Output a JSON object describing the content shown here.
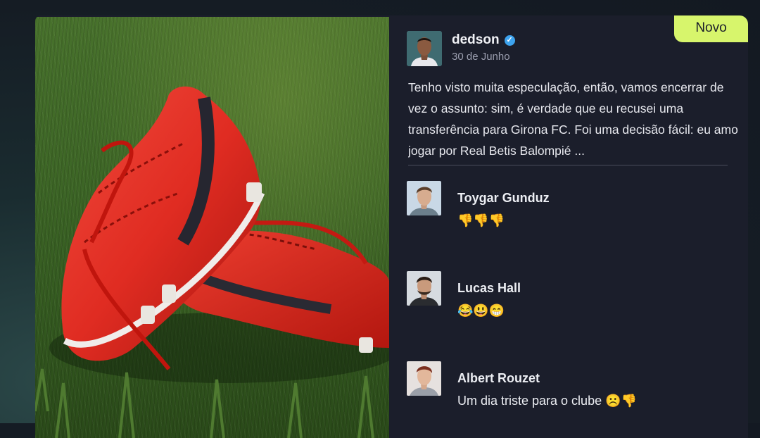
{
  "badge": "Novo",
  "post": {
    "author": "dedson",
    "verified": true,
    "date": "30 de Junho",
    "text": "Tenho visto muita especulação, então, vamos encerrar de vez o assunto: sim, é verdade que eu recusei uma transferência para Girona FC. Foi uma decisão fácil: eu amo jogar por Real Betis Balompié ..."
  },
  "comments": [
    {
      "author": "Toygar Gunduz",
      "text": "👎👎👎"
    },
    {
      "author": "Lucas Hall",
      "text": "😂😃😁"
    },
    {
      "author": "Albert Rouzet",
      "text": "Um dia triste para o clube ☹️👎"
    }
  ],
  "colors": {
    "badge": "#d7f56c",
    "card": "#1b1e2b",
    "verified": "#3da3ee"
  }
}
